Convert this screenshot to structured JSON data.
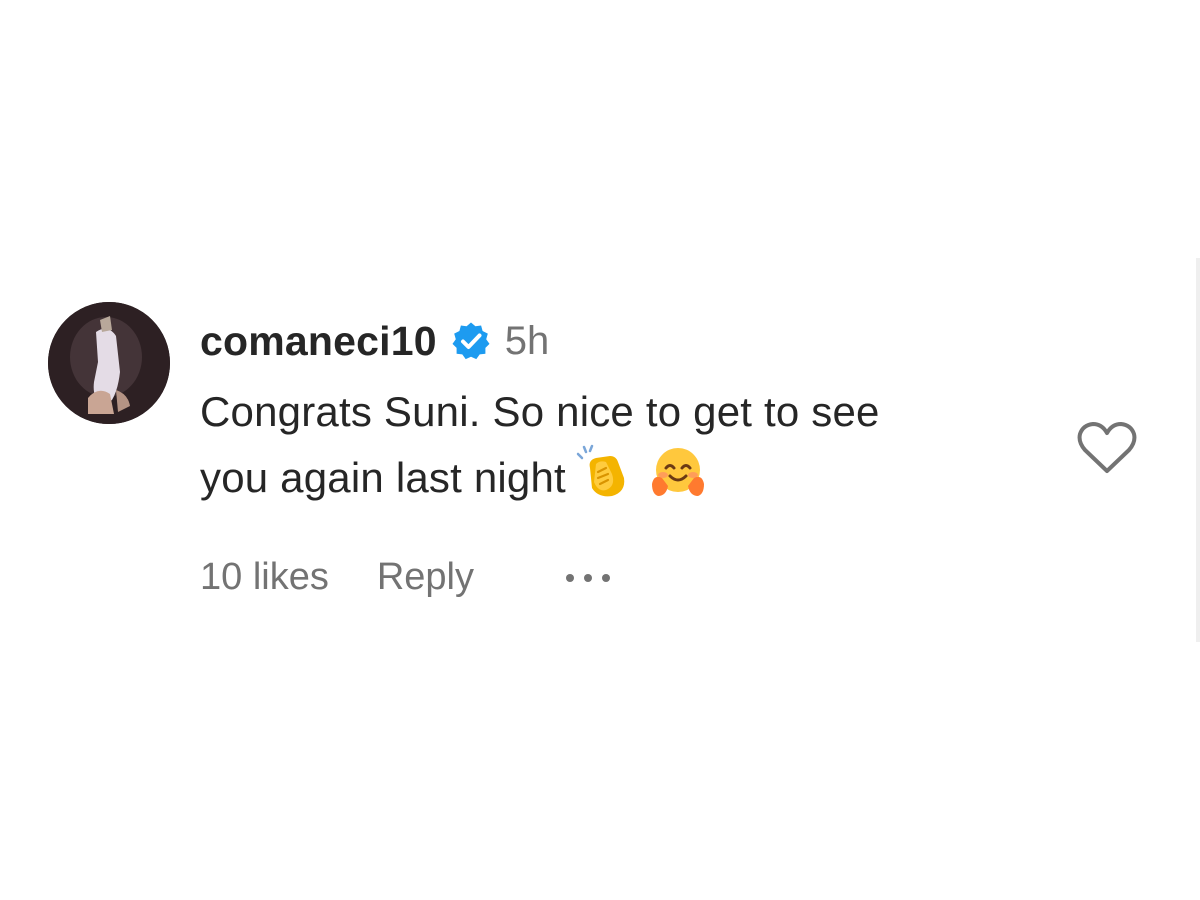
{
  "comment": {
    "username": "comaneci10",
    "verified": true,
    "time": "5h",
    "text_line1": "Congrats Suni. So nice to get to see",
    "text_line2": "you again last night",
    "emojis": [
      "clapping-hands",
      "smiling-face-with-open-hands"
    ],
    "likes": "10 likes",
    "reply_label": "Reply",
    "liked": false
  },
  "colors": {
    "text": "#262626",
    "secondary": "#737373",
    "verified": "#1d9bf0"
  },
  "icons": {
    "verified": "verified-badge-icon",
    "like": "heart-icon",
    "more": "more-options-icon"
  }
}
